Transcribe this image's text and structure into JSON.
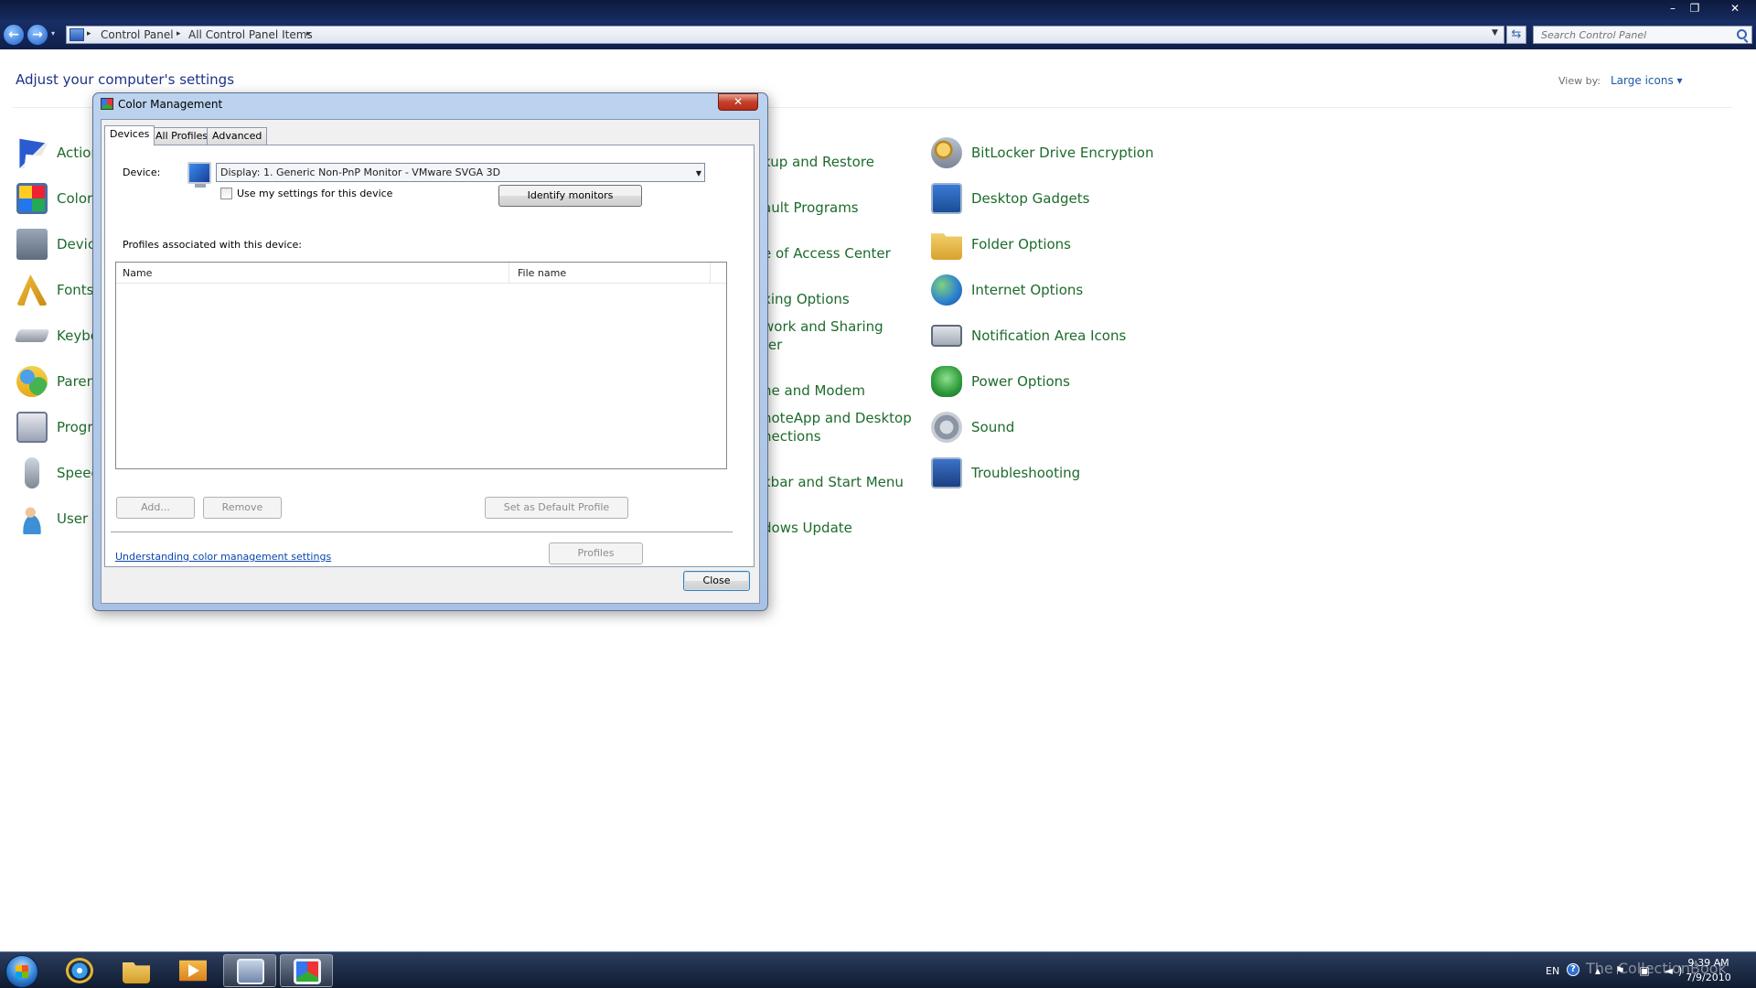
{
  "window": {
    "minimize_glyph": "–",
    "maximize_glyph": "❐",
    "close_glyph": "✕"
  },
  "navigation": {
    "back_glyph": "←",
    "forward_glyph": "→",
    "dropdown_glyph": "▾",
    "breadcrumbs": [
      "Control Panel",
      "All Control Panel Items"
    ],
    "separator_glyph": "▸",
    "refresh_glyph": "⇆",
    "search_placeholder": "Search Control Panel"
  },
  "content": {
    "heading": "Adjust your computer's settings",
    "view_by_label": "View by:",
    "view_by_value": "Large icons ▾",
    "left_column": [
      {
        "label": "Action",
        "icon": "action-center-flag-icon"
      },
      {
        "label": "Color",
        "icon": "color-management-icon"
      },
      {
        "label": "Devic",
        "icon": "device-manager-icon"
      },
      {
        "label": "Fonts",
        "icon": "fonts-icon"
      },
      {
        "label": "Keybo",
        "icon": "keyboard-icon"
      },
      {
        "label": "Paren",
        "icon": "parental-controls-icon"
      },
      {
        "label": "Progr",
        "icon": "programs-icon"
      },
      {
        "label": "Speec",
        "icon": "speech-microphone-icon"
      },
      {
        "label": "User a",
        "icon": "user-accounts-icon"
      }
    ],
    "middle_column": [
      {
        "label": "kup and Restore"
      },
      {
        "label": "ault Programs"
      },
      {
        "label": "e of Access Center"
      },
      {
        "label": "xing Options"
      },
      {
        "label": "work and Sharing\nter"
      },
      {
        "label": "ne and Modem"
      },
      {
        "label": "noteApp and Desktop\nnections"
      },
      {
        "label": "kbar and Start Menu"
      },
      {
        "label": "dows Update"
      }
    ],
    "right_column": [
      {
        "label": "BitLocker Drive Encryption",
        "icon": "bitlocker-key-icon"
      },
      {
        "label": "Desktop Gadgets",
        "icon": "desktop-gadgets-icon"
      },
      {
        "label": "Folder Options",
        "icon": "folder-options-icon"
      },
      {
        "label": "Internet Options",
        "icon": "internet-options-globe-icon"
      },
      {
        "label": "Notification Area Icons",
        "icon": "notification-area-icon"
      },
      {
        "label": "Power Options",
        "icon": "power-options-icon"
      },
      {
        "label": "Sound",
        "icon": "sound-speaker-icon"
      },
      {
        "label": "Troubleshooting",
        "icon": "troubleshooting-icon"
      }
    ]
  },
  "dialog": {
    "title": "Color Management",
    "close_glyph": "✕",
    "tabs": [
      "Devices",
      "All Profiles",
      "Advanced"
    ],
    "device_label": "Device:",
    "device_value": "Display: 1. Generic Non-PnP Monitor - VMware SVGA 3D",
    "select_arrow_glyph": "▼",
    "use_my_settings_label": "Use my settings for this device",
    "use_my_settings_checked": false,
    "identify_button": "Identify monitors",
    "profiles_label": "Profiles associated with this device:",
    "columns": [
      "Name",
      "File name"
    ],
    "rows": [],
    "add_button": "Add...",
    "remove_button": "Remove",
    "set_default_button": "Set as Default Profile",
    "help_link": "Understanding color management settings",
    "profiles_button": "Profiles",
    "close_button": "Close"
  },
  "taskbar": {
    "apps": [
      "internet-explorer-icon",
      "windows-explorer-icon",
      "media-player-icon",
      "control-panel-icon",
      "color-management-icon"
    ],
    "language": "EN",
    "help_glyph": "?",
    "tray_glyphs": "▴ ⚑ ▣ ◄)",
    "time": "9:39 AM",
    "date": "7/9/2010",
    "watermark": "The CollectionBook"
  }
}
